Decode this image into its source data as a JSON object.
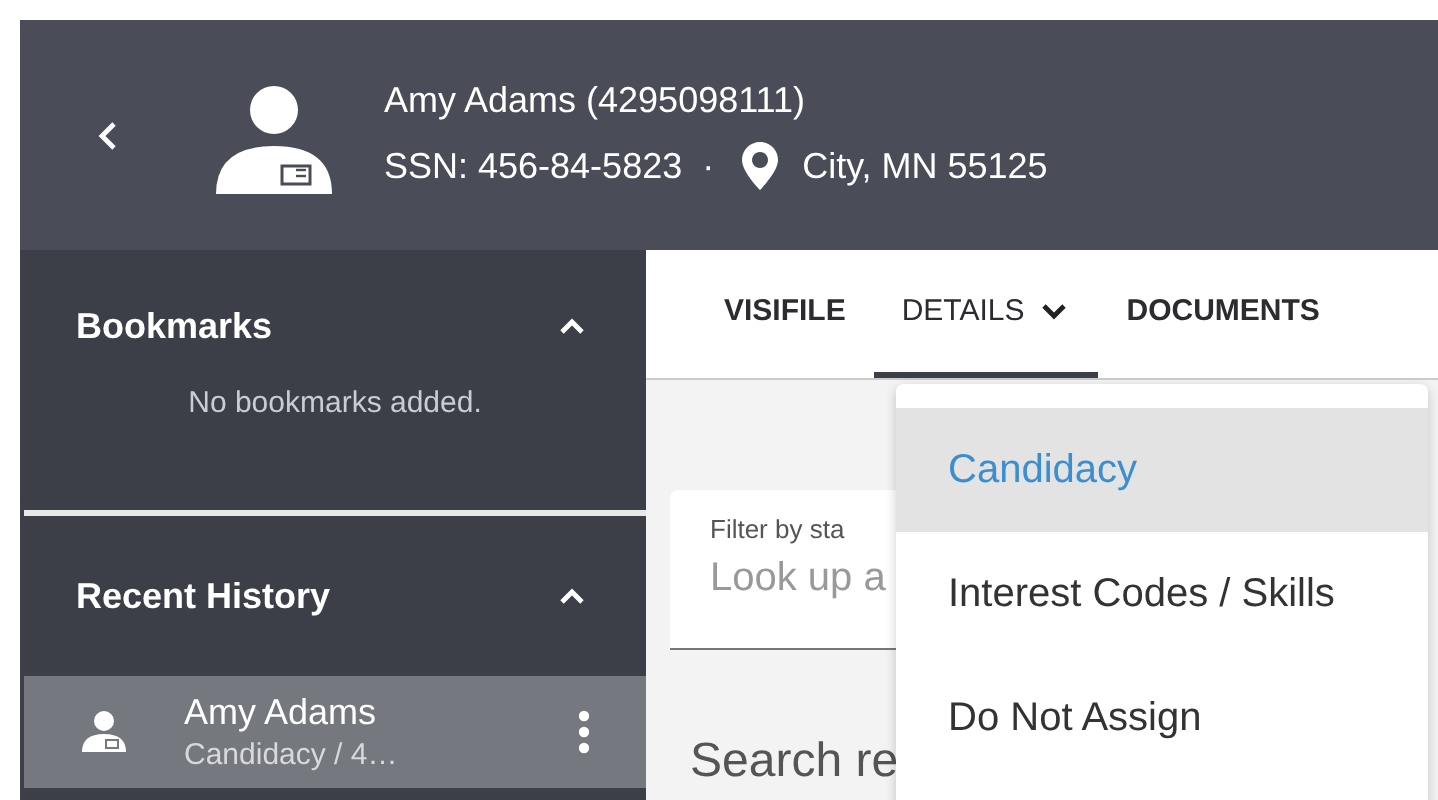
{
  "header": {
    "name": "Amy Adams (4295098111)",
    "ssn": "SSN: 456-84-5823",
    "separator": "·",
    "location": "City, MN 55125"
  },
  "sidebar": {
    "sections": [
      {
        "title": "Bookmarks",
        "expanded": true,
        "empty_text": "No bookmarks added."
      },
      {
        "title": "Recent History",
        "expanded": true,
        "items": [
          {
            "name": "Amy Adams",
            "subtitle": "Candidacy / 4…",
            "selected": true
          }
        ]
      }
    ]
  },
  "tabs": [
    {
      "label": "VISIFILE",
      "selected": false,
      "dropdown": false
    },
    {
      "label": "DETAILS",
      "selected": true,
      "dropdown": true
    },
    {
      "label": "DOCUMENTS",
      "selected": false,
      "dropdown": false
    }
  ],
  "filter": {
    "label": "Filter by sta",
    "placeholder": "Look up a"
  },
  "search_heading": "Search re",
  "menu": [
    {
      "label": "Candidacy",
      "selected": true
    },
    {
      "label": "Interest Codes / Skills",
      "selected": false
    },
    {
      "label": "Do Not Assign",
      "selected": false
    }
  ]
}
